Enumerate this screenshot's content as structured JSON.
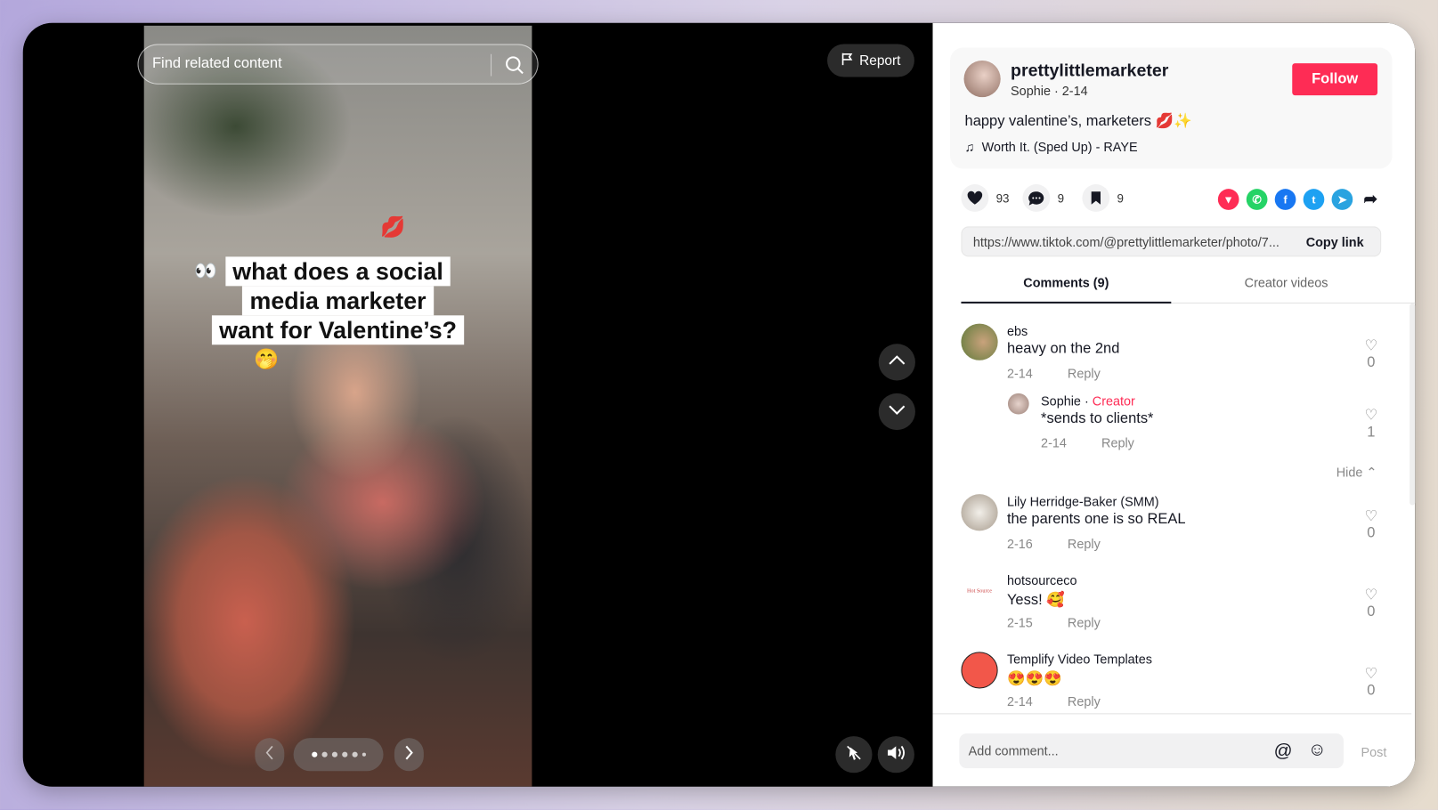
{
  "search": {
    "placeholder": "Find related content",
    "icon": "search-icon"
  },
  "report_label": "Report",
  "photo": {
    "caption_lines": [
      "what does a social",
      "media marketer",
      "want for Valentine’s?"
    ],
    "eyes_emoji": "👀",
    "kiss_emoji": "💋",
    "face_emoji": "🤭",
    "page_count": 6,
    "current_page": 1
  },
  "post": {
    "username": "prettylittlemarketer",
    "display_name": "Sophie",
    "date": "2-14",
    "sub": "Sophie · 2-14",
    "follow_label": "Follow",
    "description": "happy valentine’s, marketers 💋✨",
    "music": "Worth It. (Sped Up) - RAYE",
    "likes": "93",
    "comments": "9",
    "saves": "9",
    "link": "https://www.tiktok.com/@prettylittlemarketer/photo/7...",
    "copy_label": "Copy link"
  },
  "share_targets": [
    "repost",
    "whatsapp",
    "facebook",
    "twitter",
    "telegram",
    "share"
  ],
  "tabs": {
    "comments": "Comments (9)",
    "creator_videos": "Creator videos"
  },
  "comments": [
    {
      "user": "ebs",
      "text": "heavy on the 2nd",
      "date": "2-14",
      "reply": "Reply",
      "likes": "0"
    },
    {
      "user": "Sophie",
      "badge": "Creator",
      "text": "*sends to clients*",
      "date": "2-14",
      "reply": "Reply",
      "likes": "1"
    },
    {
      "user": "Lily Herridge-Baker (SMM)",
      "text": "the parents one is so REAL",
      "date": "2-16",
      "reply": "Reply",
      "likes": "0"
    },
    {
      "user": "hotsourceco",
      "text": "Yess! 🥰",
      "date": "2-15",
      "reply": "Reply",
      "likes": "0",
      "avatar_text": "Hot Source"
    },
    {
      "user": "Templify Video Templates",
      "text": "😍😍😍",
      "date": "2-14",
      "reply": "Reply",
      "likes": "0"
    }
  ],
  "hide_label": "Hide ⌃",
  "composer": {
    "placeholder": "Add comment...",
    "post_label": "Post"
  },
  "colors": {
    "accent": "#fe2c55",
    "whatsapp": "#25d366",
    "facebook": "#1877f2",
    "twitter": "#1da1f2",
    "telegram": "#2aa3e0"
  }
}
